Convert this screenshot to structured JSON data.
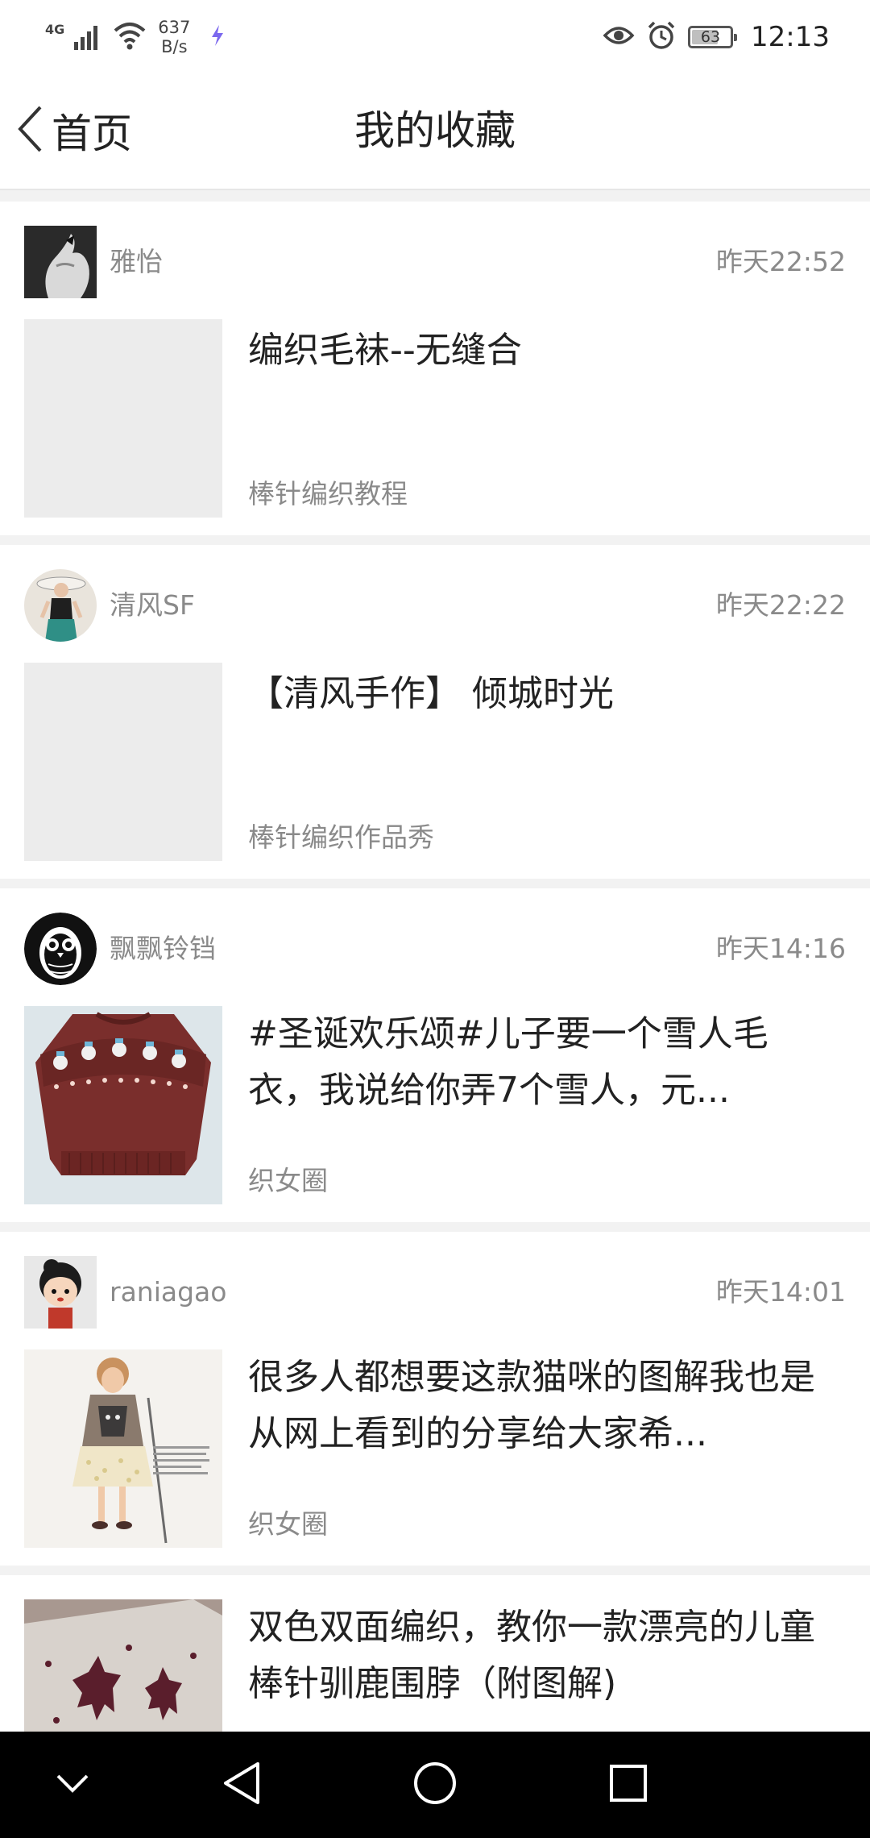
{
  "status_bar": {
    "network": "4G",
    "speed_value": "637",
    "speed_unit": "B/s",
    "battery": "63",
    "battery_level": 0.63,
    "time": "12:13"
  },
  "nav": {
    "back_label": "首页",
    "title": "我的收藏"
  },
  "items": [
    {
      "author": "雅怡",
      "time": "昨天22:52",
      "title": "编织毛袜--无缝合",
      "source": "棒针编织教程",
      "avatar": "hand-photo",
      "thumb": "blank"
    },
    {
      "author": "清风SF",
      "time": "昨天22:22",
      "title": "【清风手作】 倾城时光",
      "source": "棒针编织作品秀",
      "avatar": "woman-photo",
      "thumb": "blank"
    },
    {
      "author": "飘飘铃铛",
      "time": "昨天14:16",
      "title": "#圣诞欢乐颂#儿子要一个雪人毛衣，我说给你弄7个雪人，元...",
      "source": "织女圈",
      "avatar": "owl-illustration",
      "thumb": "sweater-photo"
    },
    {
      "author": "raniagao",
      "time": "昨天14:01",
      "title": "很多人都想要这款猫咪的图解我也是从网上看到的分享给大家希...",
      "source": "织女圈",
      "avatar": "cartoon-girl",
      "thumb": "girl-cat-sweater-photo"
    },
    {
      "author": "",
      "time": "",
      "title": "双色双面编织，教你一款漂亮的儿童棒针驯鹿围脖（附图解)",
      "source": "",
      "avatar": "",
      "thumb": "reindeer-scarf-photo"
    }
  ]
}
